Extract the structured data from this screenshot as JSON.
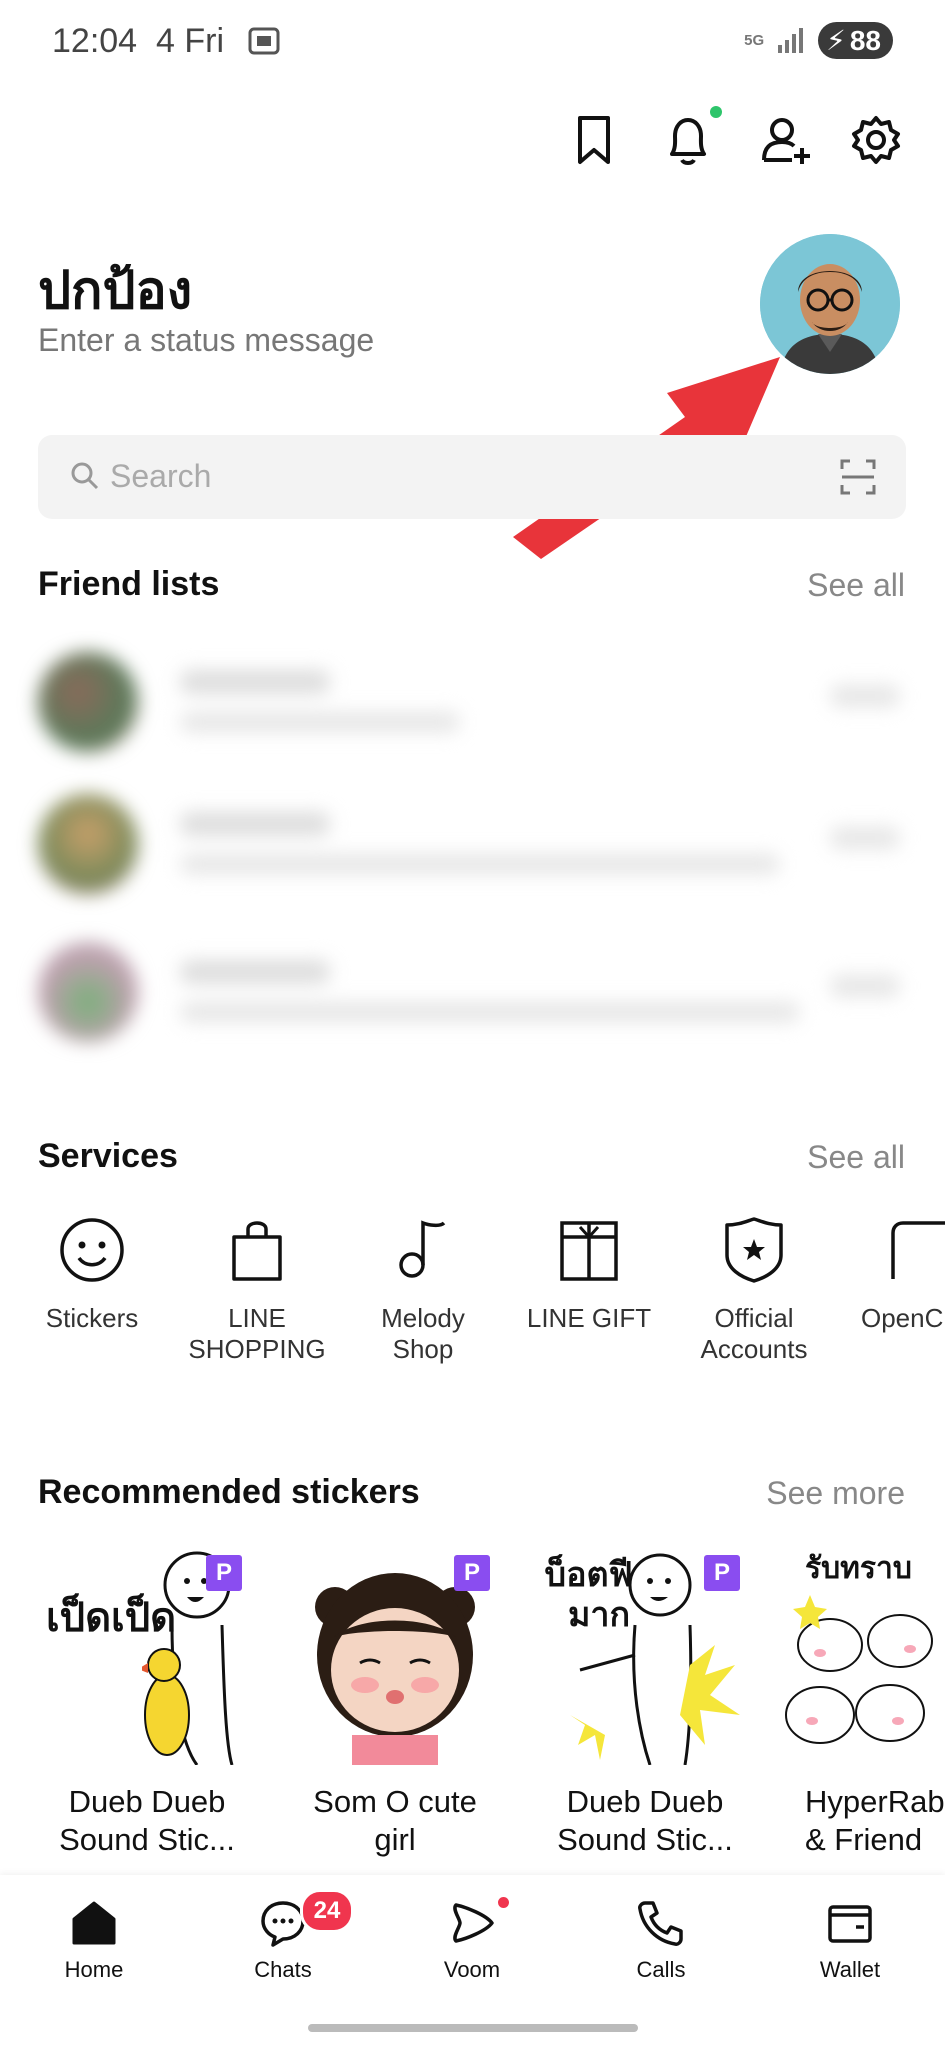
{
  "status_bar": {
    "time": "12:04",
    "date": "4 Fri",
    "network": "5G",
    "battery": "88"
  },
  "header": {
    "icons": [
      "bookmark-icon",
      "bell-icon",
      "add-friend-icon",
      "gear-icon"
    ]
  },
  "profile": {
    "name": "ปกป้อง",
    "status_placeholder": "Enter a status message"
  },
  "search": {
    "placeholder": "Search"
  },
  "friends": {
    "title": "Friend lists",
    "see_all": "See all"
  },
  "services": {
    "title": "Services",
    "see_all": "See all",
    "items": [
      {
        "label_line1": "Stickers",
        "label_line2": "",
        "icon": "smile-icon"
      },
      {
        "label_line1": "LINE",
        "label_line2": "SHOPPING",
        "icon": "shopping-bag-icon"
      },
      {
        "label_line1": "Melody",
        "label_line2": "Shop",
        "icon": "music-note-icon"
      },
      {
        "label_line1": "LINE GIFT",
        "label_line2": "",
        "icon": "gift-icon"
      },
      {
        "label_line1": "Official",
        "label_line2": "Accounts",
        "icon": "shield-star-icon"
      },
      {
        "label_line1": "OpenCh",
        "label_line2": "",
        "icon": "open-chat-icon"
      }
    ]
  },
  "stickers": {
    "title": "Recommended stickers",
    "see_more": "See more",
    "badge": "P",
    "items": [
      {
        "line1": "Dueb Dueb",
        "line2": "Sound Stic...",
        "art_text": "เป็ดเป็ด"
      },
      {
        "line1": "Som O cute",
        "line2": "girl",
        "art_text": ""
      },
      {
        "line1": "Dueb Dueb",
        "line2": "Sound Stic...",
        "art_text": "บ็อตฟีล มาก"
      },
      {
        "line1": "HyperRab",
        "line2": "& Friend",
        "art_text": "รับทราบ"
      }
    ]
  },
  "bottom_nav": {
    "items": [
      {
        "label": "Home",
        "icon": "home-icon"
      },
      {
        "label": "Chats",
        "icon": "chat-icon"
      },
      {
        "label": "Voom",
        "icon": "voom-icon"
      },
      {
        "label": "Calls",
        "icon": "phone-icon"
      },
      {
        "label": "Wallet",
        "icon": "wallet-icon"
      }
    ],
    "chats_badge": "24"
  },
  "colors": {
    "accent_red": "#f0354e",
    "online_green": "#2ec56b",
    "premium_purple": "#8a4df0",
    "annotation_arrow": "#e8343a"
  }
}
